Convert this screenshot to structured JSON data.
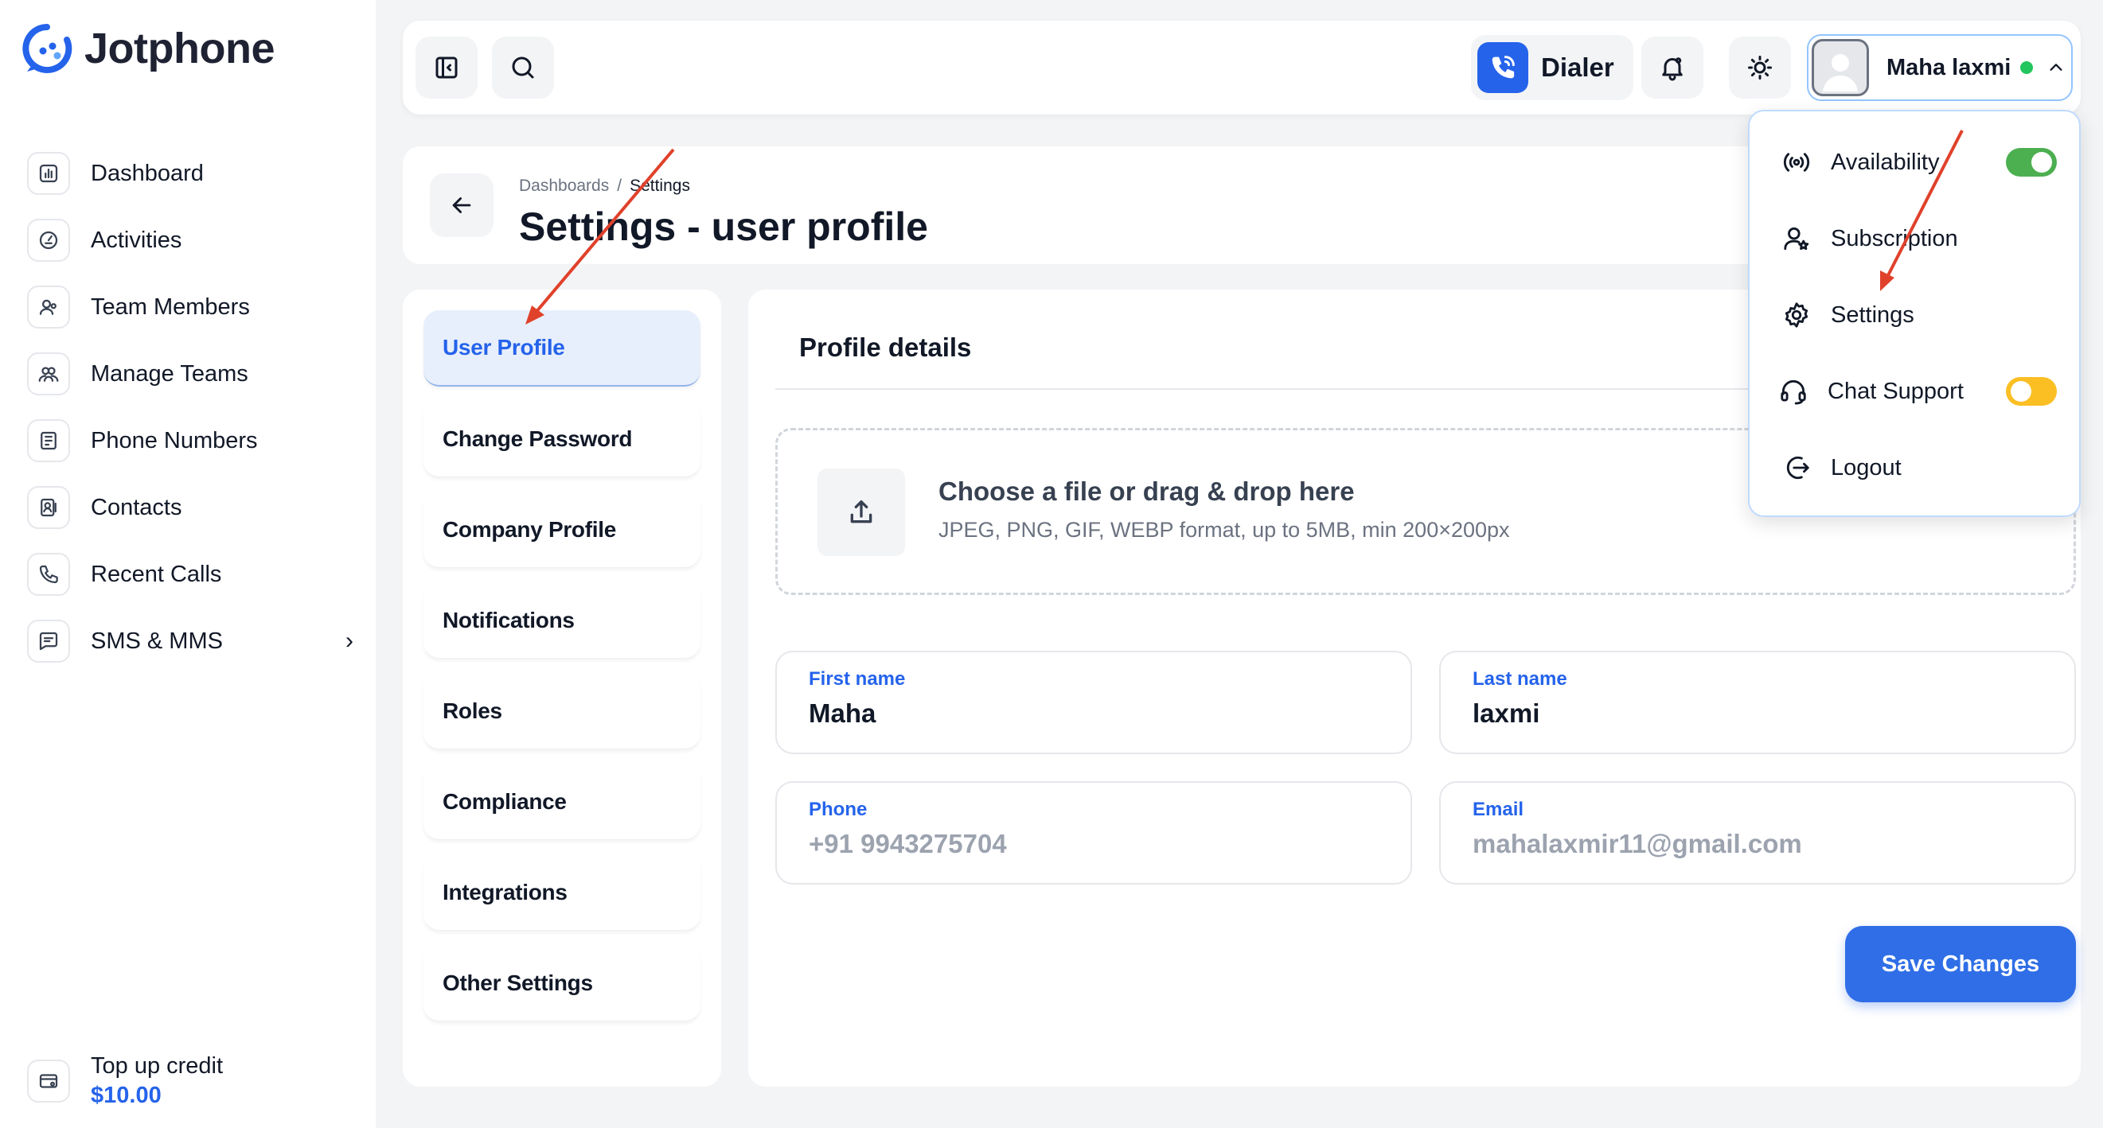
{
  "app": {
    "name": "Jotphone"
  },
  "sidebar": {
    "items": [
      {
        "label": "Dashboard",
        "icon": "chart-icon"
      },
      {
        "label": "Activities",
        "icon": "activity-icon"
      },
      {
        "label": "Team Members",
        "icon": "team-member-icon"
      },
      {
        "label": "Manage Teams",
        "icon": "teams-icon"
      },
      {
        "label": "Phone Numbers",
        "icon": "phone-numbers-icon"
      },
      {
        "label": "Contacts",
        "icon": "contacts-icon"
      },
      {
        "label": "Recent Calls",
        "icon": "recent-calls-icon"
      },
      {
        "label": "SMS & MMS",
        "icon": "message-icon"
      }
    ],
    "credit": {
      "label": "Top up credit",
      "amount": "$10.00"
    }
  },
  "topbar": {
    "dialer_label": "Dialer",
    "user_name": "Maha laxmi",
    "online_color": "#22c55e"
  },
  "header": {
    "breadcrumb": [
      "Dashboards",
      "Settings"
    ],
    "title": "Settings - user profile"
  },
  "settings_menu": [
    "User Profile",
    "Change Password",
    "Company Profile",
    "Notifications",
    "Roles",
    "Compliance",
    "Integrations",
    "Other Settings"
  ],
  "profile": {
    "title": "Profile details",
    "upload_title": "Choose a file or drag & drop here",
    "upload_hint": "JPEG, PNG, GIF, WEBP format, up to 5MB, min 200×200px",
    "first_name_label": "First name",
    "first_name": "Maha",
    "last_name_label": "Last name",
    "last_name": "laxmi",
    "phone_label": "Phone",
    "phone": "+91 9943275704",
    "email_label": "Email",
    "email": "mahalaxmir11@gmail.com",
    "save_label": "Save Changes"
  },
  "dropdown": {
    "availability": "Availability",
    "subscription": "Subscription",
    "settings": "Settings",
    "chat_support": "Chat Support",
    "logout": "Logout"
  },
  "colors": {
    "accent": "#2563eb",
    "toggle_on": "#4caf50",
    "toggle_warn": "#fbbf24",
    "annotation_arrow": "#e0412b"
  }
}
